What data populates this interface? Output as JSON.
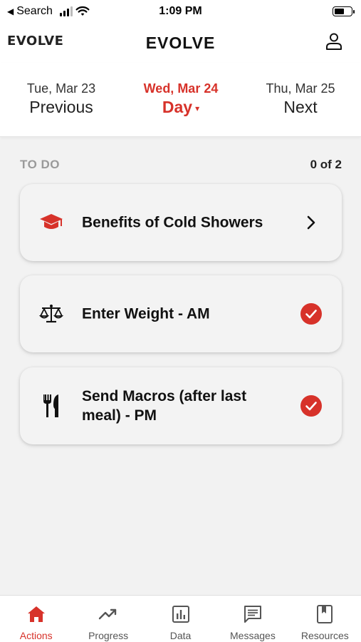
{
  "status_bar": {
    "back_label": "Search",
    "time": "1:09 PM",
    "battery_level": 0.6
  },
  "header": {
    "logo_text": "EVOLVE",
    "title": "EVOLVE",
    "profile_icon": "person-icon"
  },
  "date_nav": {
    "previous": {
      "date": "Tue, Mar 23",
      "label": "Previous"
    },
    "current": {
      "date": "Wed, Mar 24",
      "label": "Day",
      "caret": "▾"
    },
    "next": {
      "date": "Thu, Mar 25",
      "label": "Next"
    }
  },
  "todo": {
    "title": "TO DO",
    "count": "0 of 2",
    "items": [
      {
        "label": "Benefits of Cold Showers",
        "icon": "graduation-cap-icon",
        "end": "chevron-right-icon"
      },
      {
        "label": "Enter Weight - AM",
        "icon": "scale-icon",
        "end": "check-circle-icon"
      },
      {
        "label": "Send Macros (after last meal) - PM",
        "icon": "fork-knife-icon",
        "end": "check-circle-icon"
      }
    ]
  },
  "tabs": [
    {
      "label": "Actions",
      "icon": "home-icon",
      "active": true
    },
    {
      "label": "Progress",
      "icon": "trend-icon",
      "active": false
    },
    {
      "label": "Data",
      "icon": "bar-chart-icon",
      "active": false
    },
    {
      "label": "Messages",
      "icon": "message-icon",
      "active": false
    },
    {
      "label": "Resources",
      "icon": "book-icon",
      "active": false
    }
  ],
  "colors": {
    "accent": "#d7322a",
    "background": "#f2f2f2",
    "card": "#f3f3f3"
  }
}
